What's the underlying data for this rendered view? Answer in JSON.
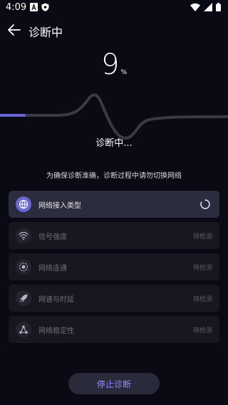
{
  "status_bar": {
    "time": "4:09",
    "left_icons": [
      "font-a-icon",
      "shield-icon"
    ],
    "right_icons": [
      "wifi-icon",
      "signal-icon",
      "battery-icon"
    ]
  },
  "header": {
    "title": "诊断中",
    "back_icon": "arrow-left-icon"
  },
  "progress": {
    "value": "9",
    "unit": "%",
    "fraction": 0.09,
    "accent_color": "#6b67d8"
  },
  "diagnosis": {
    "status": "诊断中...",
    "subtitle": "为确保诊断准确，诊断过程中请勿切换网络"
  },
  "checks": [
    {
      "label": "网络接入类型",
      "status": "",
      "icon": "network-type-icon",
      "state": "running"
    },
    {
      "label": "信号强度",
      "status": "待检测",
      "icon": "wifi-icon",
      "state": "pending"
    },
    {
      "label": "网络连通",
      "status": "待检测",
      "icon": "connectivity-icon",
      "state": "pending"
    },
    {
      "label": "网速与时延",
      "status": "待检测",
      "icon": "rocket-icon",
      "state": "pending"
    },
    {
      "label": "网络稳定性",
      "status": "待检测",
      "icon": "nodes-icon",
      "state": "pending"
    }
  ],
  "stop_button": {
    "label": "停止诊断"
  }
}
